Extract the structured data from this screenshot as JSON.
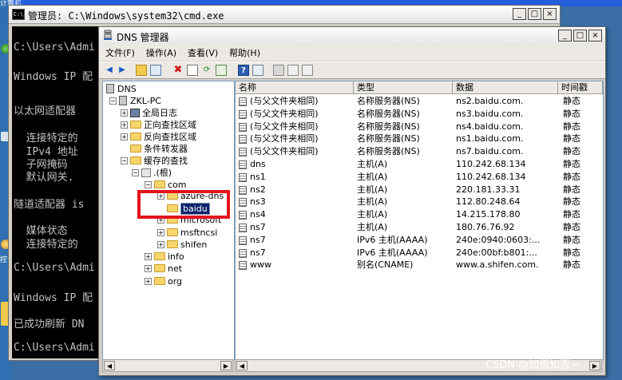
{
  "desktop": {
    "labels": [
      "计算机",
      "控"
    ]
  },
  "cmd": {
    "title": "管理员: C:\\Windows\\system32\\cmd.exe",
    "icon_text": "C:\\",
    "lines": [
      "C:\\Users\\Admi",
      "Windows IP 配",
      "以太网适配器",
      "  连接特定的",
      "  IPv4 地址",
      "  子网掩码",
      "  默认网关.",
      "隧道适配器 is",
      "  媒体状态",
      "  连接特定的",
      "C:\\Users\\Admi",
      "Windows IP 配",
      "已成功刷新 DN",
      "C:\\Users\\Admi"
    ],
    "buttons": {
      "min": "_",
      "max": "□",
      "close": "×"
    }
  },
  "dns": {
    "title": "DNS 管理器",
    "buttons": {
      "min": "_",
      "max": "□",
      "close": "×"
    },
    "menu": [
      "文件(F)",
      "操作(A)",
      "查看(V)",
      "帮助(H)"
    ],
    "tree": {
      "root": "DNS",
      "server": "ZKL-PC",
      "global_logs": "全局日志",
      "forward_zones": "正向查找区域",
      "reverse_zones": "反向查找区域",
      "conditional_forwarders": "条件转发器",
      "cached_lookups": "缓存的查找",
      "root_zone": ".(根)",
      "com": "com",
      "azure_dns": "azure-dns",
      "baidu": "baidu",
      "microsoft": "microsoft",
      "msftncsi": "msftncsi",
      "shifen": "shifen",
      "info": "info",
      "net": "net",
      "org": "org"
    },
    "columns": [
      "名称",
      "类型",
      "数据",
      "时间戳"
    ],
    "rows": [
      {
        "name": "(与父文件夹相同)",
        "type": "名称服务器(NS)",
        "data": "ns2.baidu.com.",
        "ts": "静态"
      },
      {
        "name": "(与父文件夹相同)",
        "type": "名称服务器(NS)",
        "data": "ns3.baidu.com.",
        "ts": "静态"
      },
      {
        "name": "(与父文件夹相同)",
        "type": "名称服务器(NS)",
        "data": "ns4.baidu.com.",
        "ts": "静态"
      },
      {
        "name": "(与父文件夹相同)",
        "type": "名称服务器(NS)",
        "data": "ns1.baidu.com.",
        "ts": "静态"
      },
      {
        "name": "(与父文件夹相同)",
        "type": "名称服务器(NS)",
        "data": "ns7.baidu.com.",
        "ts": "静态"
      },
      {
        "name": "dns",
        "type": "主机(A)",
        "data": "110.242.68.134",
        "ts": "静态"
      },
      {
        "name": "ns1",
        "type": "主机(A)",
        "data": "110.242.68.134",
        "ts": "静态"
      },
      {
        "name": "ns2",
        "type": "主机(A)",
        "data": "220.181.33.31",
        "ts": "静态"
      },
      {
        "name": "ns3",
        "type": "主机(A)",
        "data": "112.80.248.64",
        "ts": "静态"
      },
      {
        "name": "ns4",
        "type": "主机(A)",
        "data": "14.215.178.80",
        "ts": "静态"
      },
      {
        "name": "ns7",
        "type": "主机(A)",
        "data": "180.76.76.92",
        "ts": "静态"
      },
      {
        "name": "ns7",
        "type": "IPv6 主机(AAAA)",
        "data": "240e:0940:0603:...",
        "ts": "静态"
      },
      {
        "name": "ns7",
        "type": "IPv6 主机(AAAA)",
        "data": "240e:00bf:b801:...",
        "ts": "静态"
      },
      {
        "name": "www",
        "type": "别名(CNAME)",
        "data": "www.a.shifen.com.",
        "ts": "静态"
      }
    ]
  },
  "watermark": "CSDN @知否知否~",
  "colors": {
    "highlight": "#0a246a",
    "annotation": "#e3131b"
  }
}
